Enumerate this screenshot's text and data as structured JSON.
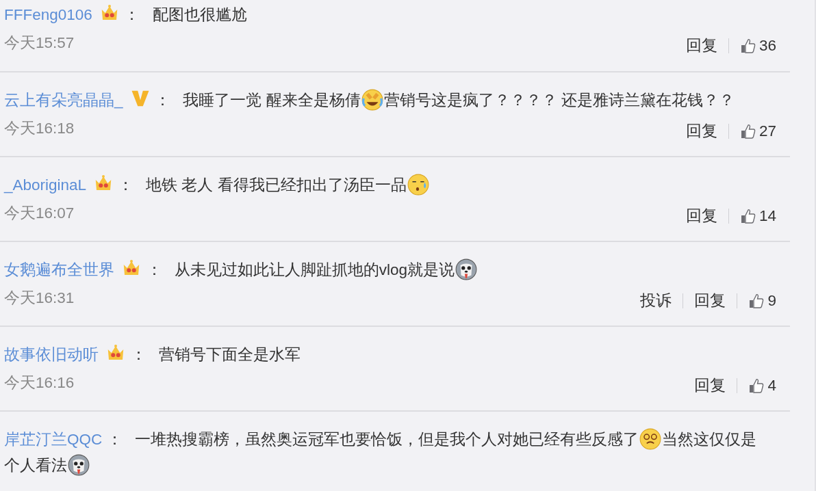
{
  "comments": [
    {
      "user": "FFFeng0106",
      "badge": {
        "kind": "crown"
      },
      "separator": "：",
      "segments": [
        {
          "kind": "text",
          "text": "配图也很尴尬"
        }
      ],
      "time": "今天15:57",
      "actions": [
        "回复"
      ],
      "likes": "36"
    },
    {
      "user": "云上有朵亮晶晶_",
      "badge": {
        "kind": "vip"
      },
      "separator": "：",
      "segments": [
        {
          "kind": "text",
          "text": "我睡了一觉 醒来全是杨倩"
        },
        {
          "kind": "laughing"
        },
        {
          "kind": "text",
          "text": "营销号这是疯了？？？？ 还是雅诗兰黛在花钱？？"
        }
      ],
      "time": "今天16:18",
      "actions": [
        "回复"
      ],
      "likes": "27"
    },
    {
      "user": "_AboriginaL",
      "badge": {
        "kind": "crown"
      },
      "separator": "：",
      "segments": [
        {
          "kind": "text",
          "text": "地铁 老人 看得我已经扣出了汤臣一品"
        },
        {
          "kind": "sweating"
        }
      ],
      "time": "今天16:07",
      "actions": [
        "回复"
      ],
      "likes": "14"
    },
    {
      "user": "女鹅遍布全世界",
      "badge": {
        "kind": "crown"
      },
      "separator": "：",
      "segments": [
        {
          "kind": "text",
          "text": "从未见过如此让人脚趾抓地的vlog就是说"
        },
        {
          "kind": "dog"
        }
      ],
      "time": "今天16:31",
      "actions": [
        "投诉",
        "回复"
      ],
      "likes": "9"
    },
    {
      "user": "故事依旧动听",
      "badge": {
        "kind": "crown"
      },
      "separator": "：",
      "segments": [
        {
          "kind": "text",
          "text": "营销号下面全是水军"
        }
      ],
      "time": "今天16:16",
      "actions": [
        "回复"
      ],
      "likes": "4"
    },
    {
      "user": "岸芷汀兰QQC",
      "separator": " ：",
      "segments": [
        {
          "kind": "text",
          "text": "一堆热搜霸榜，虽然奥运冠军也要恰饭，但是我个人对她已经有些反感了"
        },
        {
          "kind": "dizzy"
        },
        {
          "kind": "text",
          "text": "当然这仅仅是"
        },
        {
          "kind": "text",
          "text": "个人看法"
        },
        {
          "kind": "dog"
        }
      ]
    }
  ]
}
